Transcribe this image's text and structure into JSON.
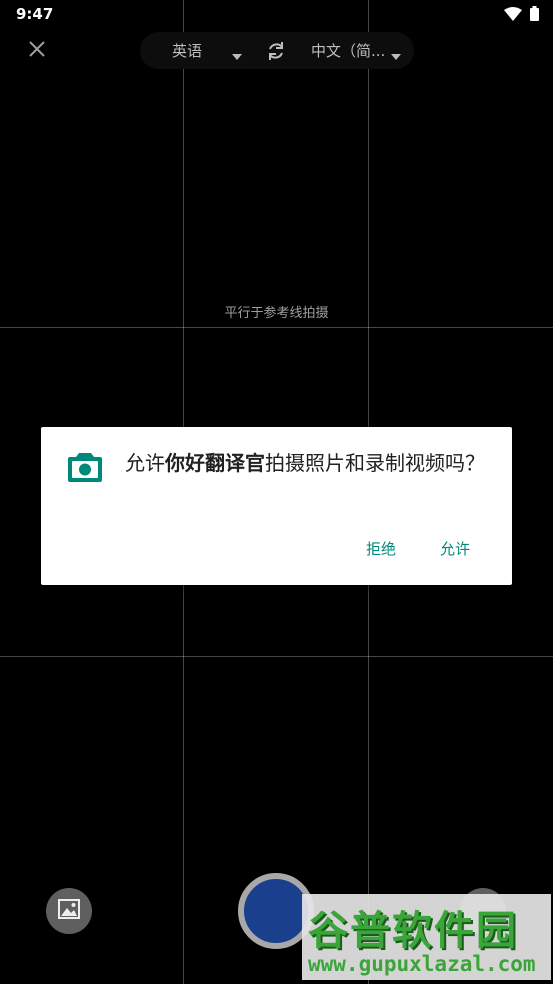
{
  "status_bar": {
    "time": "9:47",
    "icons": [
      "wifi-icon",
      "battery-icon"
    ]
  },
  "top_bar": {
    "close_icon": "close-icon",
    "source_language": "英语",
    "target_language": "中文（简...",
    "swap_icon": "swap-icon"
  },
  "camera": {
    "guide_text": "平行于参考线拍摄"
  },
  "permission_dialog": {
    "icon": "camera-icon",
    "message_prefix": "允许",
    "app_name": "你好翻译官",
    "message_suffix": "拍摄照片和录制视频吗？",
    "deny_label": "拒绝",
    "allow_label": "允许",
    "accent_color": "#00897b"
  },
  "bottom_bar": {
    "gallery_icon": "image-icon",
    "shutter_color": "#1a3f8c"
  },
  "watermark": {
    "title": "谷普软件园",
    "url": "www.gupuxlazal.com"
  }
}
